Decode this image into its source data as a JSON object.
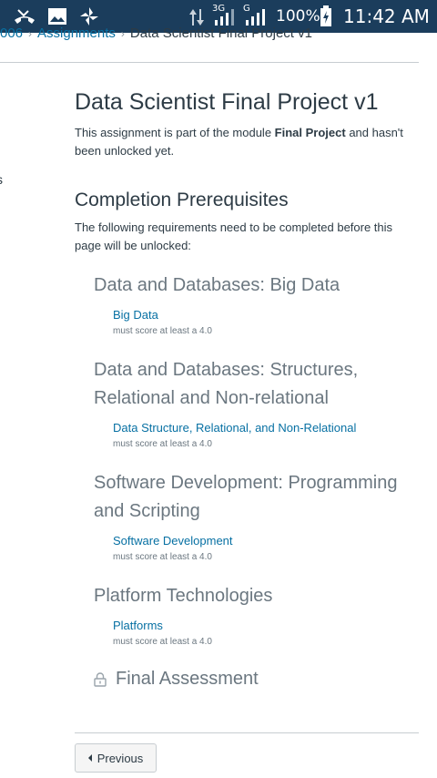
{
  "status_bar": {
    "battery_pct": "100%",
    "time": "11:42 AM",
    "network_label": "3G",
    "network_label_2": "G",
    "icons": [
      "missed-call-icon",
      "image-icon",
      "pinwheel-icon",
      "data-arrows-icon",
      "signal-3g-icon",
      "signal-g-icon",
      "battery-charging-icon"
    ]
  },
  "breadcrumb": {
    "items": [
      {
        "label": "006"
      },
      {
        "label": "Assignments"
      }
    ],
    "current": "Data Scientist Final Project v1"
  },
  "left_stub": "s",
  "page": {
    "title": "Data Scientist Final Project v1",
    "intro_prefix": "This assignment is part of the module ",
    "intro_module": "Final Project",
    "intro_suffix": " and hasn't been unlocked yet."
  },
  "prerequisites": {
    "heading": "Completion Prerequisites",
    "description": "The following requirements need to be completed before this page will be unlocked:",
    "modules": [
      {
        "title": "Data and Databases: Big Data",
        "item": "Big Data",
        "score": "must score at least a 4.0"
      },
      {
        "title": "Data and Databases: Structures, Relational and Non-relational",
        "item": "Data Structure, Relational, and Non-Relational",
        "score": "must score at least a 4.0"
      },
      {
        "title": "Software Development: Programming and Scripting",
        "item": "Software Development",
        "score": "must score at least a 4.0"
      },
      {
        "title": "Platform Technologies",
        "item": "Platforms",
        "score": "must score at least a 4.0"
      }
    ],
    "final_module": "Final Assessment"
  },
  "footer": {
    "previous_label": "Previous"
  },
  "colors": {
    "status_bar_bg": "#1b3d5c",
    "link": "#0770a3",
    "text": "#2d3b45",
    "muted": "#6b7780"
  }
}
